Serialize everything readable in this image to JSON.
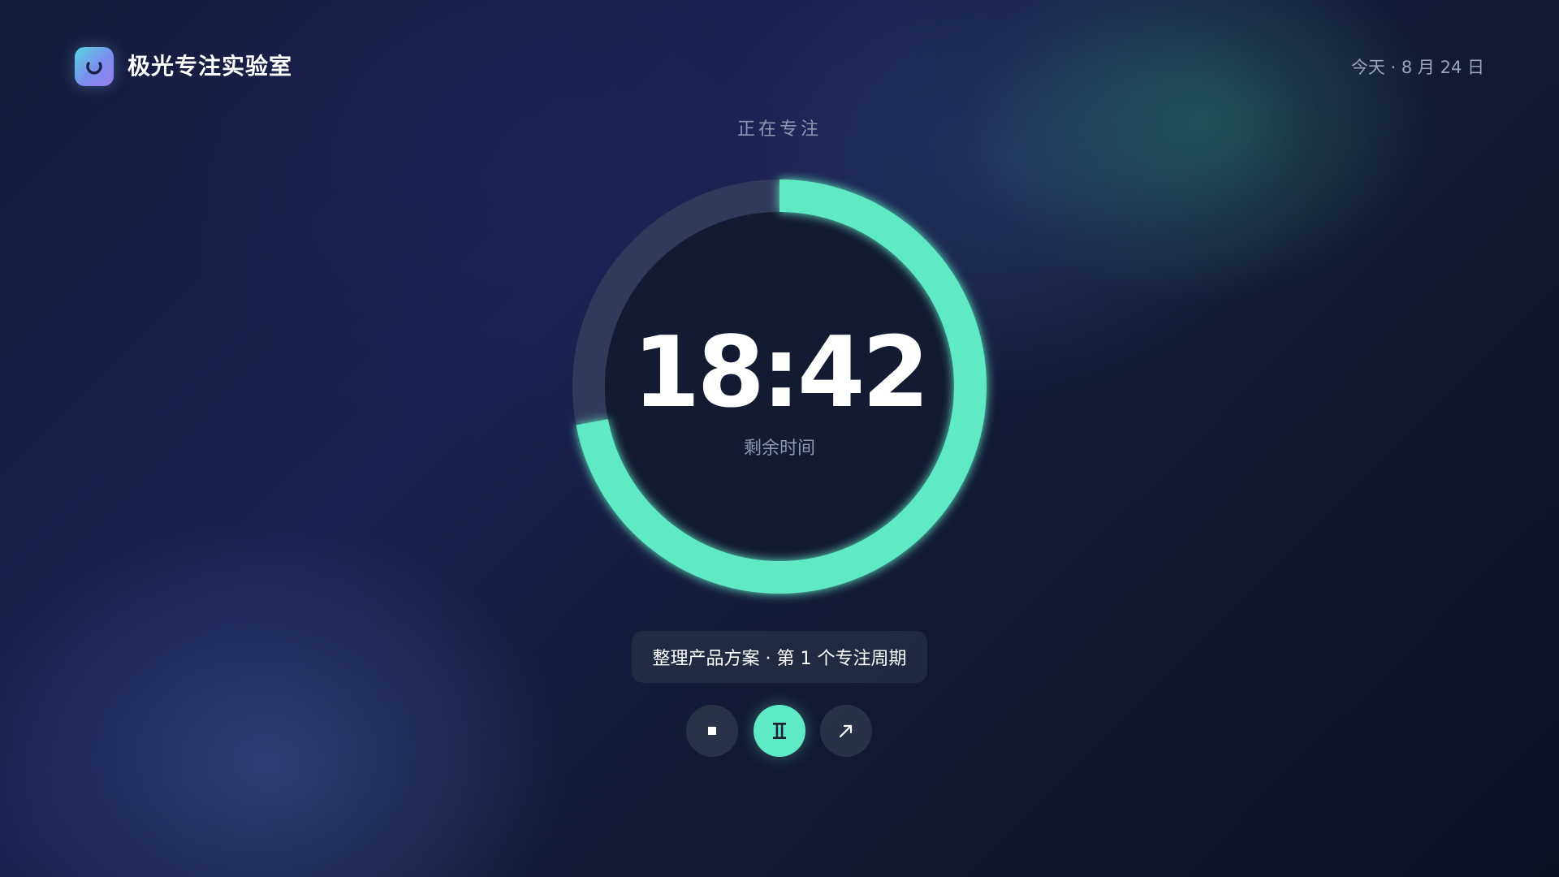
{
  "app": {
    "title": "极光专注实验室",
    "logo_icon": "refresh-ring-icon"
  },
  "header": {
    "date": "今天 · 8 月 24 日"
  },
  "timer": {
    "status": "正在专注",
    "time": "18:42",
    "caption": "剩余时间",
    "progress_fraction": 0.72,
    "accent_color": "#5eeac4",
    "track_color": "#323a5c"
  },
  "task": {
    "label": "整理产品方案 · 第 1 个专注周期"
  },
  "controls": {
    "stop_icon": "stop-icon",
    "pause_icon": "pause-icon",
    "expand_icon": "expand-icon"
  }
}
